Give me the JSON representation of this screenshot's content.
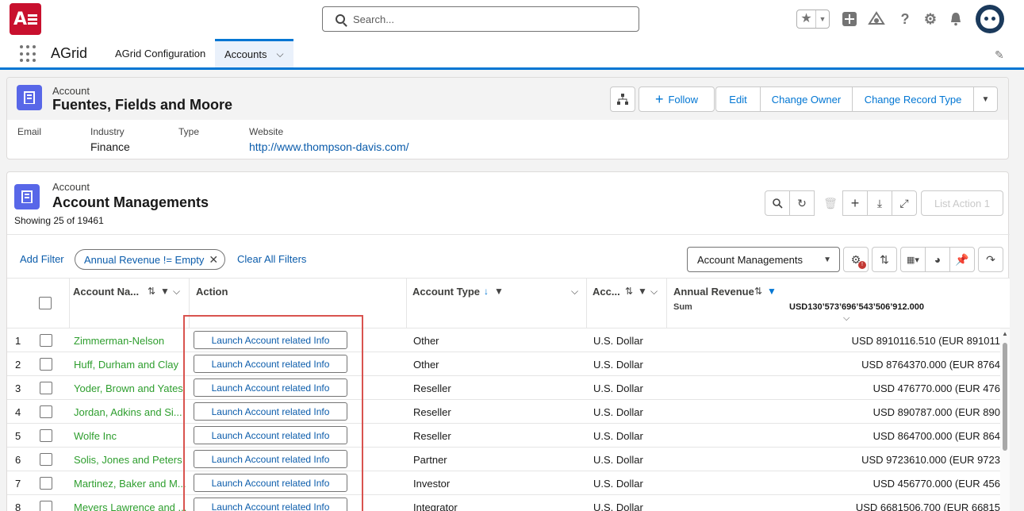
{
  "header": {
    "logo_text": "A",
    "search_placeholder": "Search...",
    "icons": [
      "star-icon",
      "add-icon",
      "setup-assistant-icon",
      "help-icon",
      "settings-icon",
      "notification-bell-icon",
      "user-avatar"
    ]
  },
  "nav": {
    "app_name": "AGrid",
    "tabs": [
      {
        "label": "AGrid Configuration",
        "active": false
      },
      {
        "label": "Accounts",
        "active": true
      }
    ]
  },
  "record": {
    "object_label": "Account",
    "title": "Fuentes, Fields and Moore",
    "buttons": {
      "follow": "Follow",
      "edit": "Edit",
      "change_owner": "Change Owner",
      "change_record_type": "Change Record Type"
    },
    "fields": [
      {
        "label": "Email",
        "value": ""
      },
      {
        "label": "Industry",
        "value": "Finance"
      },
      {
        "label": "Type",
        "value": ""
      },
      {
        "label": "Website",
        "value": "http://www.thompson-davis.com/"
      }
    ]
  },
  "grid": {
    "object_label": "Account",
    "title": "Account Managements",
    "showing": "Showing 25 of 19461",
    "list_action": "List Action 1",
    "add_filter": "Add Filter",
    "filter_pill": "Annual Revenue != Empty",
    "clear_filters": "Clear All Filters",
    "view_select": "Account Managements",
    "columns": {
      "account_name": "Account Na...",
      "action": "Action",
      "account_type": "Account Type",
      "currency": "Acc...",
      "annual_revenue": "Annual Revenue"
    },
    "sum_label": "Sum",
    "sum_value": "USD130’573’696’543’506’912.000",
    "action_label": "Launch Account related Info",
    "rows": [
      {
        "n": "1",
        "name": "Zimmerman-Nelson",
        "type": "Other",
        "currency": "U.S. Dollar",
        "revenue": "USD 8910116.510 (EUR 891011"
      },
      {
        "n": "2",
        "name": "Huff, Durham and Clay",
        "type": "Other",
        "currency": "U.S. Dollar",
        "revenue": "USD 8764370.000 (EUR 8764"
      },
      {
        "n": "3",
        "name": "Yoder, Brown and Yates",
        "type": "Reseller",
        "currency": "U.S. Dollar",
        "revenue": "USD 476770.000 (EUR 476"
      },
      {
        "n": "4",
        "name": "Jordan, Adkins and Si...",
        "type": "Reseller",
        "currency": "U.S. Dollar",
        "revenue": "USD 890787.000 (EUR 890"
      },
      {
        "n": "5",
        "name": "Wolfe Inc",
        "type": "Reseller",
        "currency": "U.S. Dollar",
        "revenue": "USD 864700.000 (EUR 864"
      },
      {
        "n": "6",
        "name": "Solis, Jones and Peters",
        "type": "Partner",
        "currency": "U.S. Dollar",
        "revenue": "USD 9723610.000 (EUR 9723"
      },
      {
        "n": "7",
        "name": "Martinez, Baker and M...",
        "type": "Investor",
        "currency": "U.S. Dollar",
        "revenue": "USD 456770.000 (EUR 456"
      },
      {
        "n": "8",
        "name": "Meyers Lawrence and ...",
        "type": "Integrator",
        "currency": "U.S. Dollar",
        "revenue": "USD 6681506.700 (EUR 66815"
      }
    ]
  }
}
